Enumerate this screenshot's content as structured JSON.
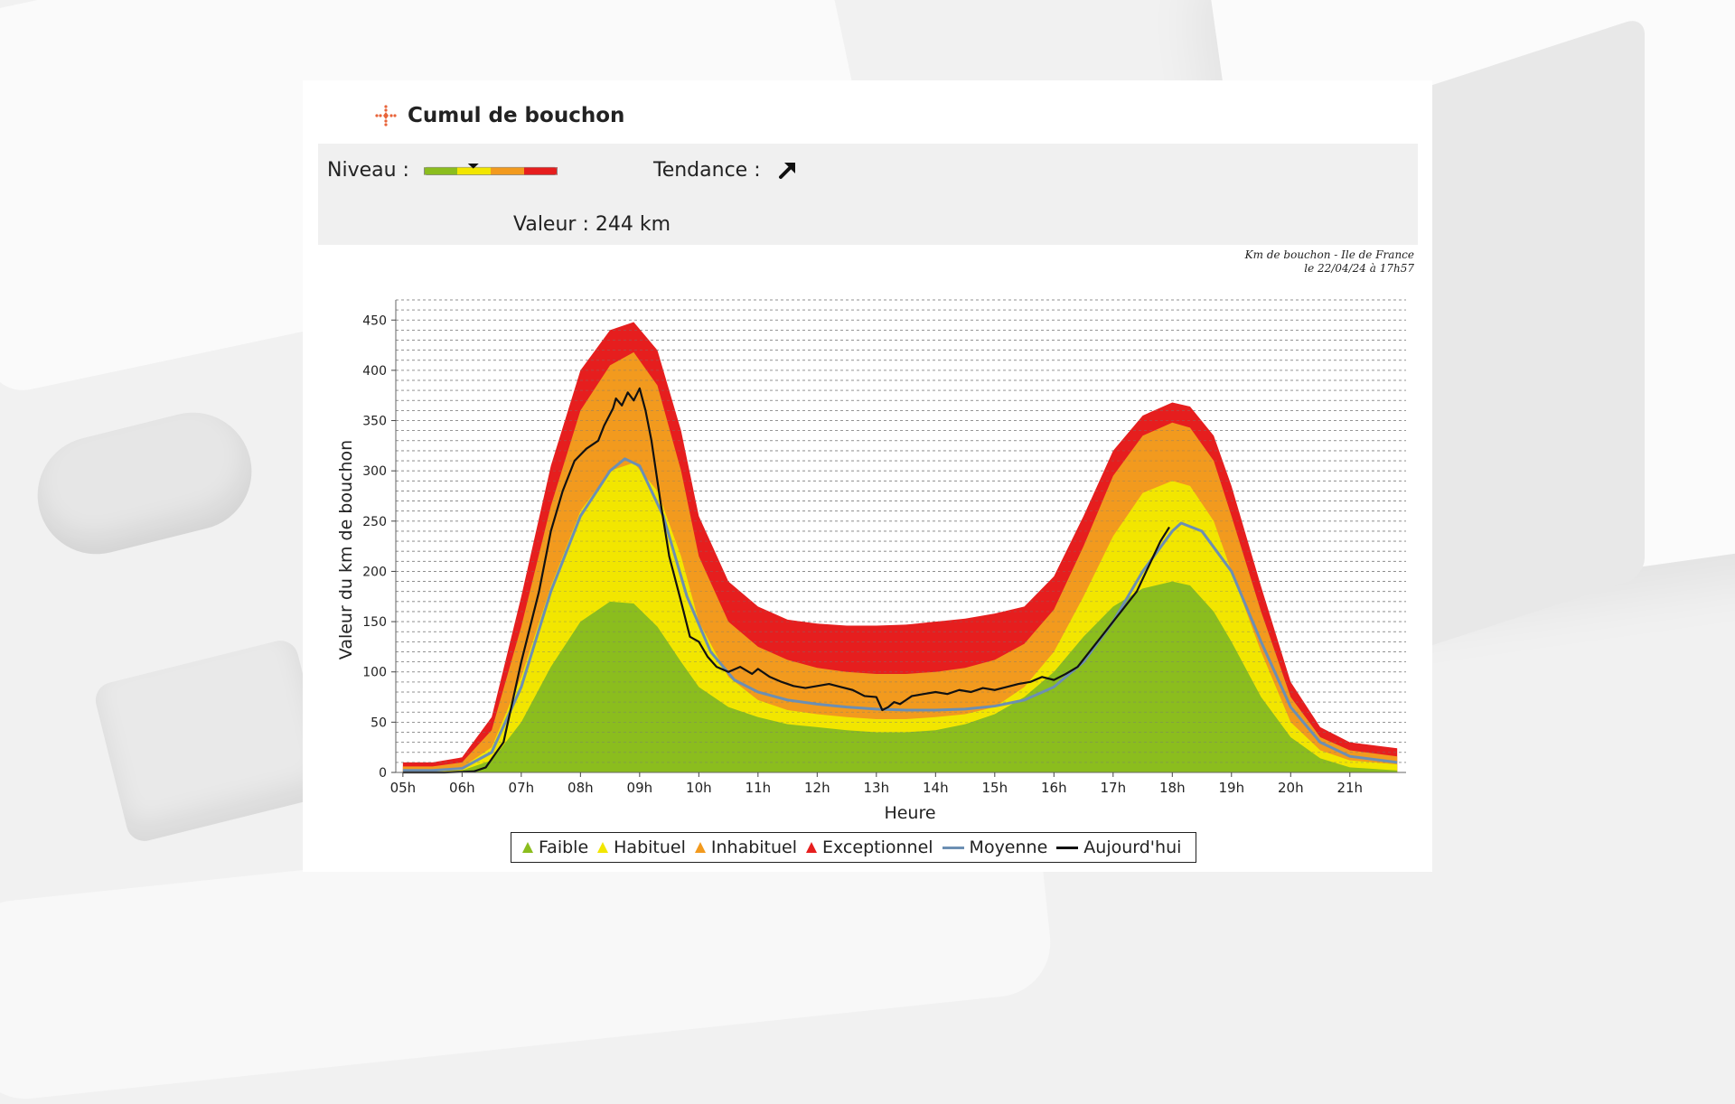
{
  "header": {
    "title": "Cumul de bouchon",
    "icon": "cross-arrows-icon",
    "icon_color": "#e8643a"
  },
  "info": {
    "level_label": "Niveau :",
    "level_fraction": 0.37,
    "level_colors": [
      "#8bbd1e",
      "#f2e600",
      "#f29a1e",
      "#e61e1e"
    ],
    "trend_label": "Tendance :",
    "trend_icon": "arrow-up-right-icon",
    "value_label": "Valeur : 244 km"
  },
  "source_note": {
    "line1": "Km de bouchon - Ile de France",
    "line2": "le 22/04/24 à 17h57"
  },
  "chart_data": {
    "type": "area",
    "xlabel": "Heure",
    "ylabel": "Valeur du  km de bouchon",
    "ylim": [
      0,
      470
    ],
    "xlim": [
      4.88,
      21.95
    ],
    "yticks": [
      0,
      50,
      100,
      150,
      200,
      250,
      300,
      350,
      400,
      450
    ],
    "xticks": [
      {
        "x": 5,
        "label": "05h"
      },
      {
        "x": 6,
        "label": "06h"
      },
      {
        "x": 7,
        "label": "07h"
      },
      {
        "x": 8,
        "label": "08h"
      },
      {
        "x": 9,
        "label": "09h"
      },
      {
        "x": 10,
        "label": "10h"
      },
      {
        "x": 11,
        "label": "11h"
      },
      {
        "x": 12,
        "label": "12h"
      },
      {
        "x": 13,
        "label": "13h"
      },
      {
        "x": 14,
        "label": "14h"
      },
      {
        "x": 15,
        "label": "15h"
      },
      {
        "x": 16,
        "label": "16h"
      },
      {
        "x": 17,
        "label": "17h"
      },
      {
        "x": 18,
        "label": "18h"
      },
      {
        "x": 19,
        "label": "19h"
      },
      {
        "x": 20,
        "label": "20h"
      },
      {
        "x": 21,
        "label": "21h"
      }
    ],
    "grid": true,
    "legend_position": "bottom",
    "x": [
      5,
      5.5,
      6,
      6.5,
      7,
      7.5,
      8,
      8.5,
      8.9,
      9.3,
      9.7,
      10,
      10.5,
      11,
      11.5,
      12,
      12.5,
      13,
      13.5,
      14,
      14.5,
      15,
      15.5,
      16,
      16.5,
      17,
      17.5,
      18,
      18.3,
      18.7,
      19,
      19.5,
      20,
      20.5,
      21,
      21.8
    ],
    "bands": [
      {
        "name": "Faible",
        "color": "#8bbd1e",
        "values": [
          0,
          0,
          2,
          12,
          50,
          105,
          150,
          170,
          168,
          145,
          110,
          85,
          65,
          55,
          48,
          45,
          42,
          40,
          40,
          42,
          48,
          58,
          75,
          100,
          135,
          165,
          183,
          190,
          186,
          160,
          130,
          75,
          35,
          14,
          5,
          2
        ]
      },
      {
        "name": "Habituel",
        "color": "#f2e600",
        "values": [
          2,
          2,
          5,
          25,
          95,
          185,
          260,
          300,
          308,
          280,
          215,
          150,
          95,
          72,
          62,
          58,
          55,
          53,
          53,
          55,
          58,
          65,
          85,
          120,
          175,
          235,
          278,
          290,
          285,
          250,
          200,
          120,
          50,
          22,
          12,
          8
        ]
      },
      {
        "name": "Inhabituel",
        "color": "#f29a1e",
        "values": [
          6,
          6,
          10,
          42,
          145,
          265,
          360,
          405,
          418,
          385,
          300,
          215,
          150,
          125,
          112,
          104,
          100,
          98,
          98,
          100,
          104,
          112,
          128,
          162,
          225,
          295,
          335,
          348,
          343,
          310,
          255,
          160,
          75,
          35,
          22,
          16
        ]
      },
      {
        "name": "Exceptionnel",
        "color": "#e61e1e",
        "values": [
          10,
          10,
          15,
          55,
          175,
          305,
          400,
          440,
          448,
          420,
          340,
          255,
          190,
          165,
          152,
          148,
          146,
          146,
          147,
          150,
          153,
          158,
          165,
          195,
          255,
          320,
          355,
          368,
          364,
          335,
          285,
          185,
          90,
          45,
          30,
          24
        ]
      }
    ],
    "series": [
      {
        "name": "Moyenne",
        "color": "#6c8fb3",
        "x": [
          5,
          5.5,
          6,
          6.5,
          7,
          7.5,
          8,
          8.5,
          8.75,
          9,
          9.4,
          9.8,
          10.2,
          10.6,
          11,
          11.5,
          12,
          12.5,
          13,
          13.5,
          14,
          14.5,
          15,
          15.5,
          16,
          16.5,
          17,
          17.5,
          18,
          18.15,
          18.5,
          19,
          19.5,
          20,
          20.5,
          21,
          21.8
        ],
        "values": [
          2,
          2,
          4,
          20,
          85,
          180,
          255,
          300,
          312,
          305,
          255,
          175,
          120,
          92,
          80,
          72,
          68,
          65,
          63,
          62,
          62,
          63,
          66,
          72,
          85,
          110,
          150,
          200,
          240,
          248,
          240,
          200,
          130,
          65,
          30,
          16,
          10
        ]
      },
      {
        "name": "Aujourd'hui",
        "color": "#111111",
        "x": [
          5,
          5.7,
          6.2,
          6.4,
          6.7,
          7,
          7.3,
          7.5,
          7.7,
          7.9,
          8.1,
          8.3,
          8.4,
          8.55,
          8.6,
          8.7,
          8.8,
          8.9,
          9,
          9.1,
          9.2,
          9.35,
          9.5,
          9.7,
          9.85,
          10,
          10.15,
          10.3,
          10.5,
          10.7,
          10.9,
          11,
          11.2,
          11.4,
          11.6,
          11.8,
          12,
          12.2,
          12.4,
          12.6,
          12.8,
          13,
          13.1,
          13.2,
          13.3,
          13.4,
          13.5,
          13.6,
          13.8,
          14,
          14.2,
          14.4,
          14.6,
          14.8,
          15,
          15.2,
          15.4,
          15.6,
          15.8,
          16,
          16.2,
          16.4,
          16.6,
          16.8,
          17,
          17.2,
          17.4,
          17.6,
          17.8,
          17.95
        ],
        "values": [
          0,
          0,
          1,
          5,
          30,
          110,
          180,
          240,
          280,
          310,
          322,
          330,
          345,
          362,
          372,
          365,
          378,
          370,
          382,
          360,
          330,
          270,
          215,
          170,
          135,
          130,
          115,
          105,
          100,
          105,
          98,
          103,
          95,
          90,
          86,
          84,
          86,
          88,
          85,
          82,
          76,
          75,
          62,
          65,
          70,
          68,
          72,
          76,
          78,
          80,
          78,
          82,
          80,
          84,
          82,
          85,
          88,
          90,
          95,
          92,
          98,
          105,
          120,
          135,
          150,
          165,
          180,
          205,
          230,
          244
        ]
      }
    ]
  }
}
